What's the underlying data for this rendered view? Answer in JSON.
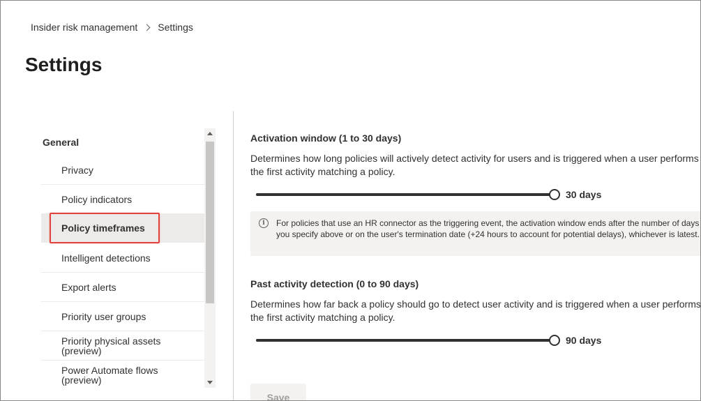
{
  "breadcrumb": {
    "items": [
      "Insider risk management",
      "Settings"
    ]
  },
  "page": {
    "title": "Settings"
  },
  "nav": {
    "group_label": "General",
    "items": [
      {
        "label": "Privacy"
      },
      {
        "label": "Policy indicators"
      },
      {
        "label": "Policy timeframes",
        "selected": true
      },
      {
        "label": "Intelligent detections"
      },
      {
        "label": "Export alerts"
      },
      {
        "label": "Priority user groups"
      },
      {
        "label": "Priority physical assets\n(preview)"
      },
      {
        "label": "Power Automate flows\n(preview)"
      }
    ]
  },
  "activation": {
    "title": "Activation window (1 to 30 days)",
    "description": "Determines how long policies will actively detect activity for users and is triggered when a user performs the first activity matching a policy.",
    "value_label": "30 days",
    "value": 30,
    "min": 1,
    "max": 30
  },
  "info": {
    "icon": "info-icon",
    "text": "For policies that use an HR connector as the triggering event, the activation window ends after the number of days you specify above or on the user's termination date (+24 hours to account for potential delays), whichever is latest."
  },
  "past_activity": {
    "title": "Past activity detection (0 to 90 days)",
    "description": "Determines how far back a policy should go to detect user activity and is triggered when a user performs the first activity matching a policy.",
    "value_label": "90 days",
    "value": 90,
    "min": 0,
    "max": 90
  },
  "actions": {
    "save_label": "Save"
  },
  "colors": {
    "highlight": "#e3423b",
    "selected_bg": "#edebe9",
    "text": "#323130"
  }
}
